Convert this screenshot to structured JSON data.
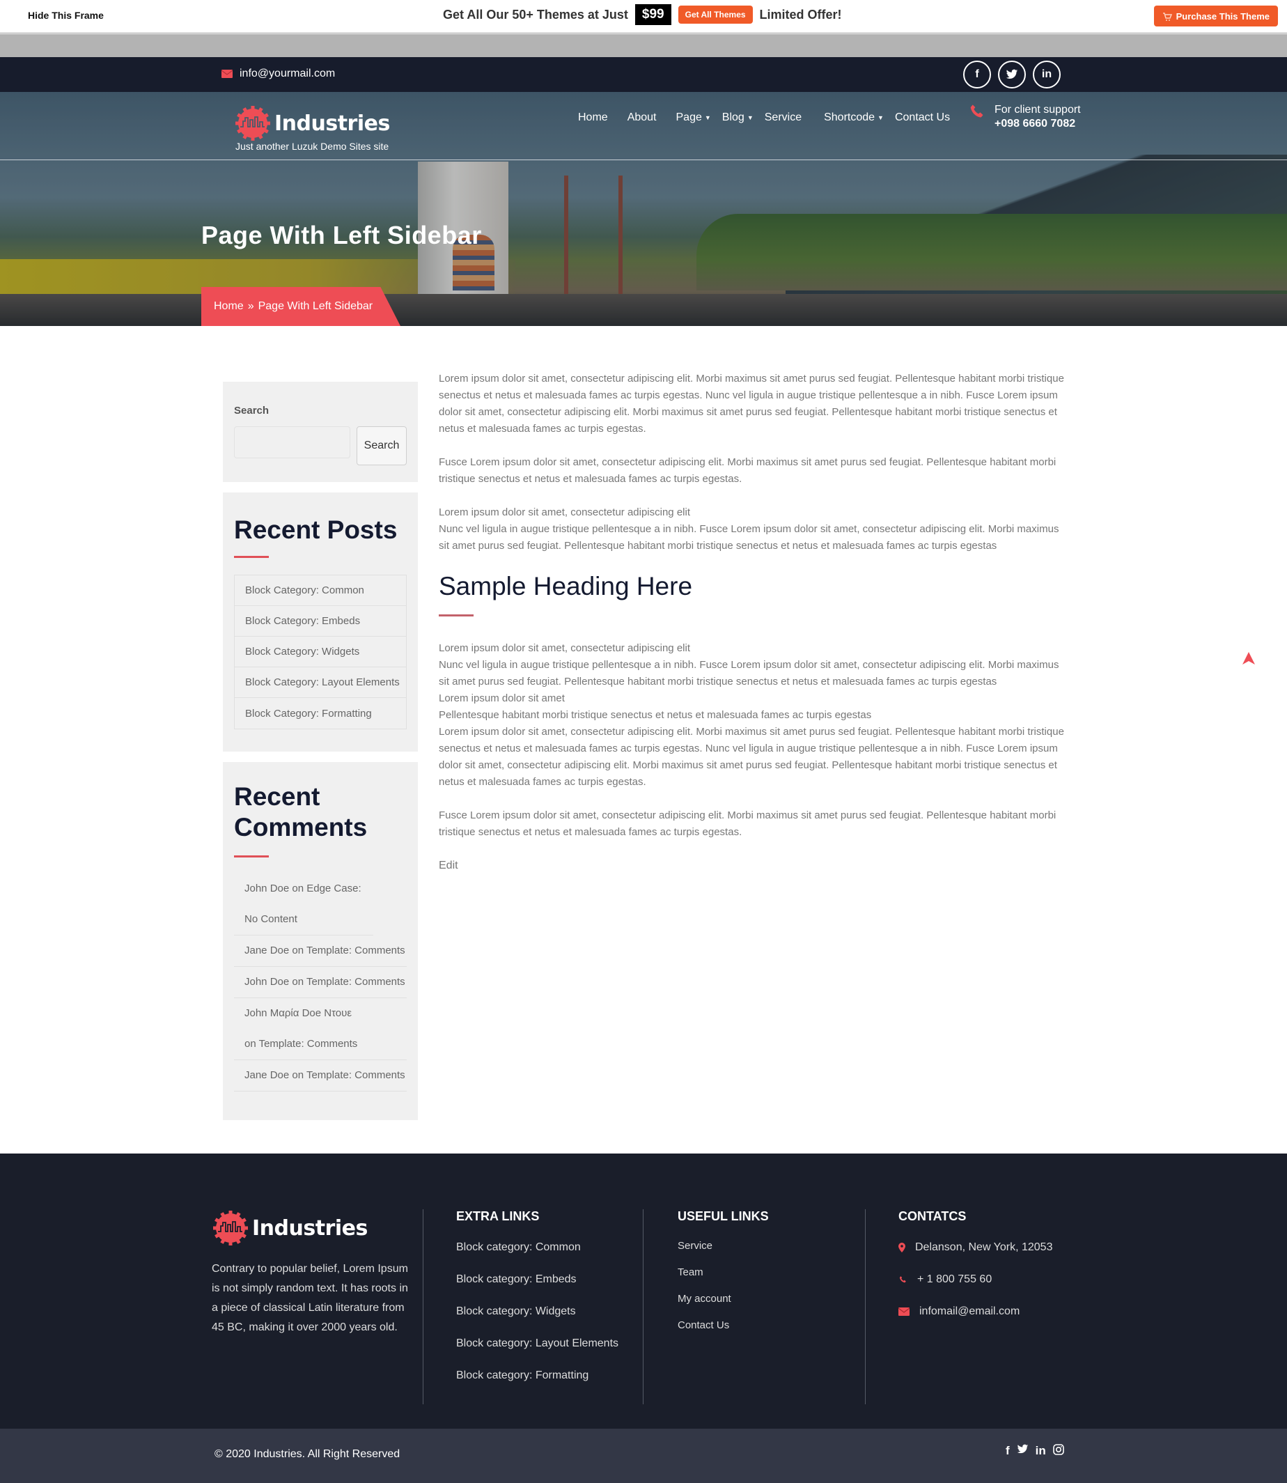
{
  "promo": {
    "hide_frame": "Hide This Frame",
    "headline": "Get All Our 50+ Themes at Just",
    "price": "$99",
    "get_all_button": "Get All Themes",
    "limited": "Limited Offer!",
    "purchase_button": "Purchase This Theme"
  },
  "topbar": {
    "email": "info@yourmail.com",
    "socials": [
      "facebook",
      "twitter",
      "linkedin"
    ]
  },
  "header": {
    "logo_text": "Industries",
    "tagline": "Just another Luzuk Demo Sites site",
    "nav": [
      {
        "label": "Home",
        "dropdown": false
      },
      {
        "label": "About",
        "dropdown": false
      },
      {
        "label": "Page",
        "dropdown": true
      },
      {
        "label": "Blog",
        "dropdown": true
      },
      {
        "label": "Service",
        "dropdown": false
      },
      {
        "label": "Shortcode",
        "dropdown": true
      },
      {
        "label": "Contact Us",
        "dropdown": false
      }
    ],
    "support_label": "For client support",
    "support_phone": "+098 6660 7082"
  },
  "hero": {
    "title": "Page With Left Sidebar",
    "breadcrumb": {
      "home": "Home",
      "separator": "»",
      "current": "Page With Left Sidebar"
    }
  },
  "sidebar": {
    "search": {
      "label": "Search",
      "value": "",
      "placeholder": "",
      "button": "Search"
    },
    "recent_posts": {
      "title": "Recent Posts",
      "items": [
        "Block Category: Common",
        "Block Category: Embeds",
        "Block Category: Widgets",
        "Block Category: Layout Elements",
        "Block Category: Formatting"
      ]
    },
    "recent_comments": {
      "title": "Recent Comments",
      "items": [
        "John Doe on Edge Case: No Content",
        "Jane Doe on Template: Comments",
        "John Doe on Template: Comments",
        "John Μαρία Doe Ντουε on Template: Comments",
        "Jane Doe on Template: Comments"
      ]
    }
  },
  "content": {
    "p1": "Lorem ipsum dolor sit amet, consectetur adipiscing elit. Morbi maximus sit amet purus sed feugiat. Pellentesque habitant morbi tristique senectus et netus et malesuada fames ac turpis egestas. Nunc vel ligula in augue tristique pellentesque a in nibh. Fusce Lorem ipsum dolor sit amet, consectetur adipiscing elit. Morbi maximus sit amet purus sed feugiat. Pellentesque habitant morbi tristique senectus et netus et malesuada fames ac turpis egestas.",
    "p2": "Fusce Lorem ipsum dolor sit amet, consectetur adipiscing elit. Morbi maximus sit amet purus sed feugiat. Pellentesque habitant morbi tristique senectus et netus et malesuada fames ac turpis egestas.",
    "p3_line1": "Lorem ipsum dolor sit amet, consectetur adipiscing elit",
    "p3_line2": "Nunc vel ligula in augue tristique pellentesque a in nibh. Fusce Lorem ipsum dolor sit amet, consectetur adipiscing elit. Morbi maximus sit amet purus sed feugiat. Pellentesque habitant morbi tristique senectus et netus et malesuada fames ac turpis egestas",
    "heading": "Sample Heading Here",
    "p4_line1": "Lorem ipsum dolor sit amet, consectetur adipiscing elit",
    "p4_line2": "Nunc vel ligula in augue tristique pellentesque a in nibh. Fusce Lorem ipsum dolor sit amet, consectetur adipiscing elit. Morbi maximus sit amet purus sed feugiat. Pellentesque habitant morbi tristique senectus et netus et malesuada fames ac turpis egestas",
    "p4_line3": "Lorem ipsum dolor sit amet",
    "p4_line4": "Pellentesque habitant morbi tristique senectus et netus et malesuada fames ac turpis egestas",
    "p4_line5": "Lorem ipsum dolor sit amet, consectetur adipiscing elit. Morbi maximus sit amet purus sed feugiat. Pellentesque habitant morbi tristique senectus et netus et malesuada fames ac turpis egestas. Nunc vel ligula in augue tristique pellentesque a in nibh. Fusce Lorem ipsum dolor sit amet, consectetur adipiscing elit. Morbi maximus sit amet purus sed feugiat. Pellentesque habitant morbi tristique senectus et netus et malesuada fames ac turpis egestas.",
    "p5": "Fusce Lorem ipsum dolor sit amet, consectetur adipiscing elit. Morbi maximus sit amet purus sed feugiat. Pellentesque habitant morbi tristique senectus et netus et malesuada fames ac turpis egestas.",
    "edit_link": "Edit"
  },
  "footer": {
    "logo_text": "Industries",
    "about": "Contrary to popular belief, Lorem Ipsum is not simply random text. It has roots in a piece of classical Latin literature from 45 BC, making it over 2000 years old.",
    "extra_links": {
      "title": "EXTRA LINKS",
      "items": [
        "Block category: Common",
        "Block category: Embeds",
        "Block category: Widgets",
        "Block category: Layout Elements",
        "Block category: Formatting"
      ]
    },
    "useful_links": {
      "title": "USEFUL LINKS",
      "items": [
        "Service",
        "Team",
        "My account",
        "Contact Us"
      ]
    },
    "contacts": {
      "title": "CONTATCS",
      "address": "Delanson, New York, 12053",
      "phone": "+ 1 800 755 60",
      "email": "infomail@email.com"
    },
    "copyright": "© 2020 Industries. All Right Reserved",
    "socials": [
      "facebook",
      "twitter",
      "linkedin",
      "instagram"
    ]
  },
  "colors": {
    "accent": "#ee4d55",
    "promo_orange": "#f05a28",
    "navy": "#171c2c",
    "footer_bg": "#1a1e2a",
    "bottom_bar": "#333746"
  }
}
